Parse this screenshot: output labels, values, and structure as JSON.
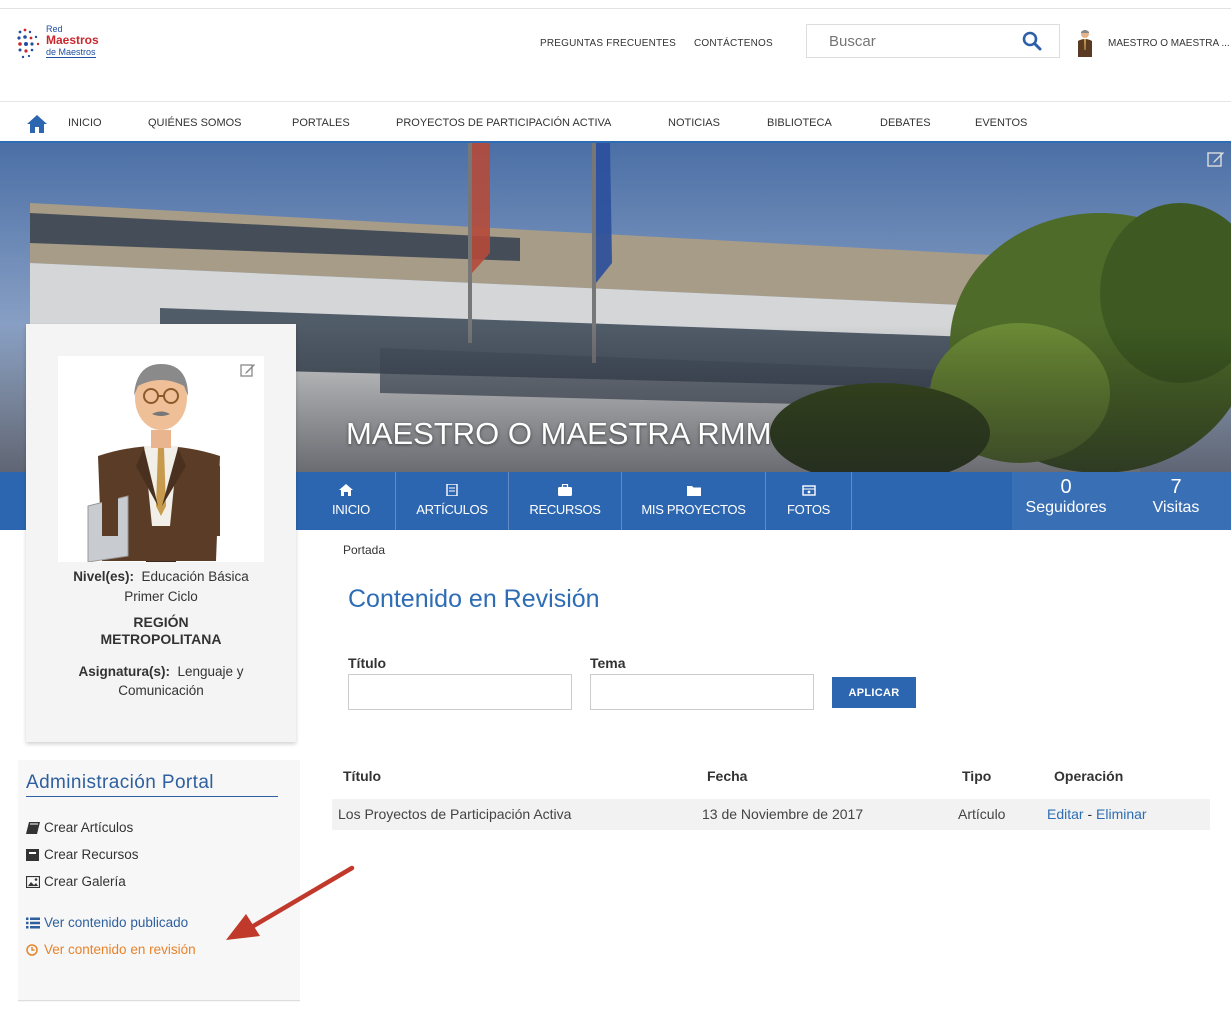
{
  "brand": {
    "line1": "Red",
    "line2": "Maestros",
    "line3": "de Maestros"
  },
  "header": {
    "faq_label": "PREGUNTAS FRECUENTES",
    "contact_label": "CONTÁCTENOS",
    "search_placeholder": "Buscar",
    "user_name": "MAESTRO O MAESTRA ..."
  },
  "main_nav": {
    "items": [
      {
        "label": "INICIO"
      },
      {
        "label": "QUIÉNES SOMOS"
      },
      {
        "label": "PORTALES"
      },
      {
        "label": "PROYECTOS DE PARTICIPACIÓN ACTIVA"
      },
      {
        "label": "NOTICIAS"
      },
      {
        "label": "BIBLIOTECA"
      },
      {
        "label": "DEBATES"
      },
      {
        "label": "EVENTOS"
      }
    ]
  },
  "profile": {
    "name": "MAESTRO O MAESTRA RMM",
    "level_label": "Nivel(es):",
    "level_value": "Educación Básica",
    "level_value_2": "Primer Ciclo",
    "region_line1": "REGIÓN",
    "region_line2": "METROPOLITANA",
    "subject_label": "Asignatura(s):",
    "subject_value": "Lenguaje y",
    "subject_value_2": "Comunicación"
  },
  "profile_tabs": [
    {
      "label": "INICIO",
      "icon": "home-icon"
    },
    {
      "label": "ARTÍCULOS",
      "icon": "article-icon"
    },
    {
      "label": "RECURSOS",
      "icon": "briefcase-icon"
    },
    {
      "label": "MIS PROYECTOS",
      "icon": "folder-icon"
    },
    {
      "label": "FOTOS",
      "icon": "photo-icon"
    }
  ],
  "stats": {
    "followers_count": "0",
    "followers_label": "Seguidores",
    "visits_count": "7",
    "visits_label": "Visitas"
  },
  "admin": {
    "title": "Administración Portal",
    "links": [
      {
        "label": "Crear Artículos",
        "icon": "book-icon"
      },
      {
        "label": "Crear Recursos",
        "icon": "resource-icon"
      },
      {
        "label": "Crear Galería",
        "icon": "image-icon"
      },
      {
        "label": "Ver contenido publicado",
        "icon": "list-icon"
      },
      {
        "label": "Ver contenido en revisión",
        "icon": "clock-icon"
      }
    ]
  },
  "content": {
    "breadcrumb": "Portada",
    "page_title": "Contenido en Revisión",
    "filter_title_label": "Título",
    "filter_topic_label": "Tema",
    "filter_title_value": "",
    "filter_topic_value": "",
    "apply_label": "APLICAR",
    "table": {
      "headers": [
        "Título",
        "Fecha",
        "Tipo",
        "Operación"
      ],
      "rows": [
        {
          "title": "Los Proyectos de Participación Activa",
          "date": "13 de Noviembre de 2017",
          "type": "Artículo",
          "edit": "Editar",
          "separator": " - ",
          "delete": "Eliminar"
        }
      ]
    }
  },
  "colors": {
    "primary_blue": "#2d66b0",
    "link_blue": "#2e6db4",
    "highlight_orange": "#e8832a",
    "annotation_red": "#c0392b"
  }
}
